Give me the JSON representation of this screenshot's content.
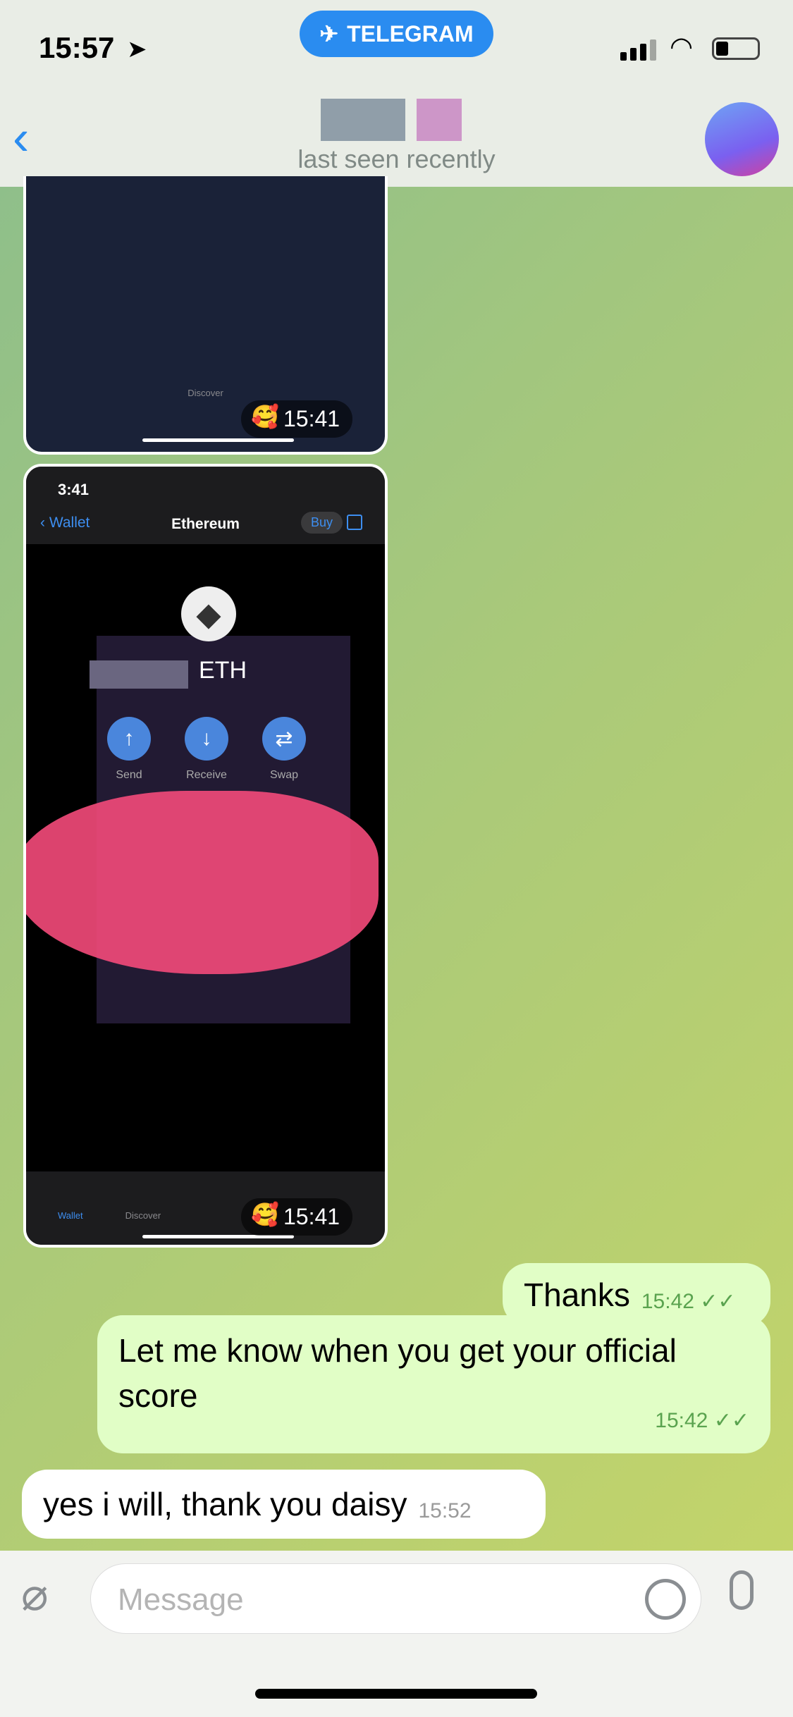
{
  "status_bar": {
    "time": "15:57",
    "app_badge": "TELEGRAM"
  },
  "header": {
    "back_icon": "chevron-left-icon",
    "subtitle": "last seen recently"
  },
  "messages": [
    {
      "type": "image",
      "direction": "incoming",
      "time": "15:41",
      "reaction": "🥰",
      "content": {
        "tabs": [
          "Discover"
        ]
      }
    },
    {
      "type": "image",
      "direction": "incoming",
      "time": "15:41",
      "reaction": "🥰",
      "content": {
        "phone_time": "3:41",
        "back_label": "Wallet",
        "title": "Ethereum",
        "buy_label": "Buy",
        "currency": "ETH",
        "actions": [
          "Send",
          "Receive",
          "Swap"
        ],
        "tabs": [
          "Wallet",
          "Discover"
        ]
      }
    },
    {
      "type": "text",
      "direction": "outgoing",
      "text": "Thanks",
      "time": "15:42",
      "status": "read"
    },
    {
      "type": "text",
      "direction": "outgoing",
      "text": "Let me know when you get your official score",
      "time": "15:42",
      "status": "read"
    },
    {
      "type": "text",
      "direction": "incoming",
      "text": "yes i will, thank you daisy",
      "time": "15:52"
    }
  ],
  "composer": {
    "placeholder": "Message"
  },
  "colors": {
    "accent": "#2a8cf0",
    "outgoing_bubble": "#e1fec6",
    "check": "#5aa34f"
  }
}
